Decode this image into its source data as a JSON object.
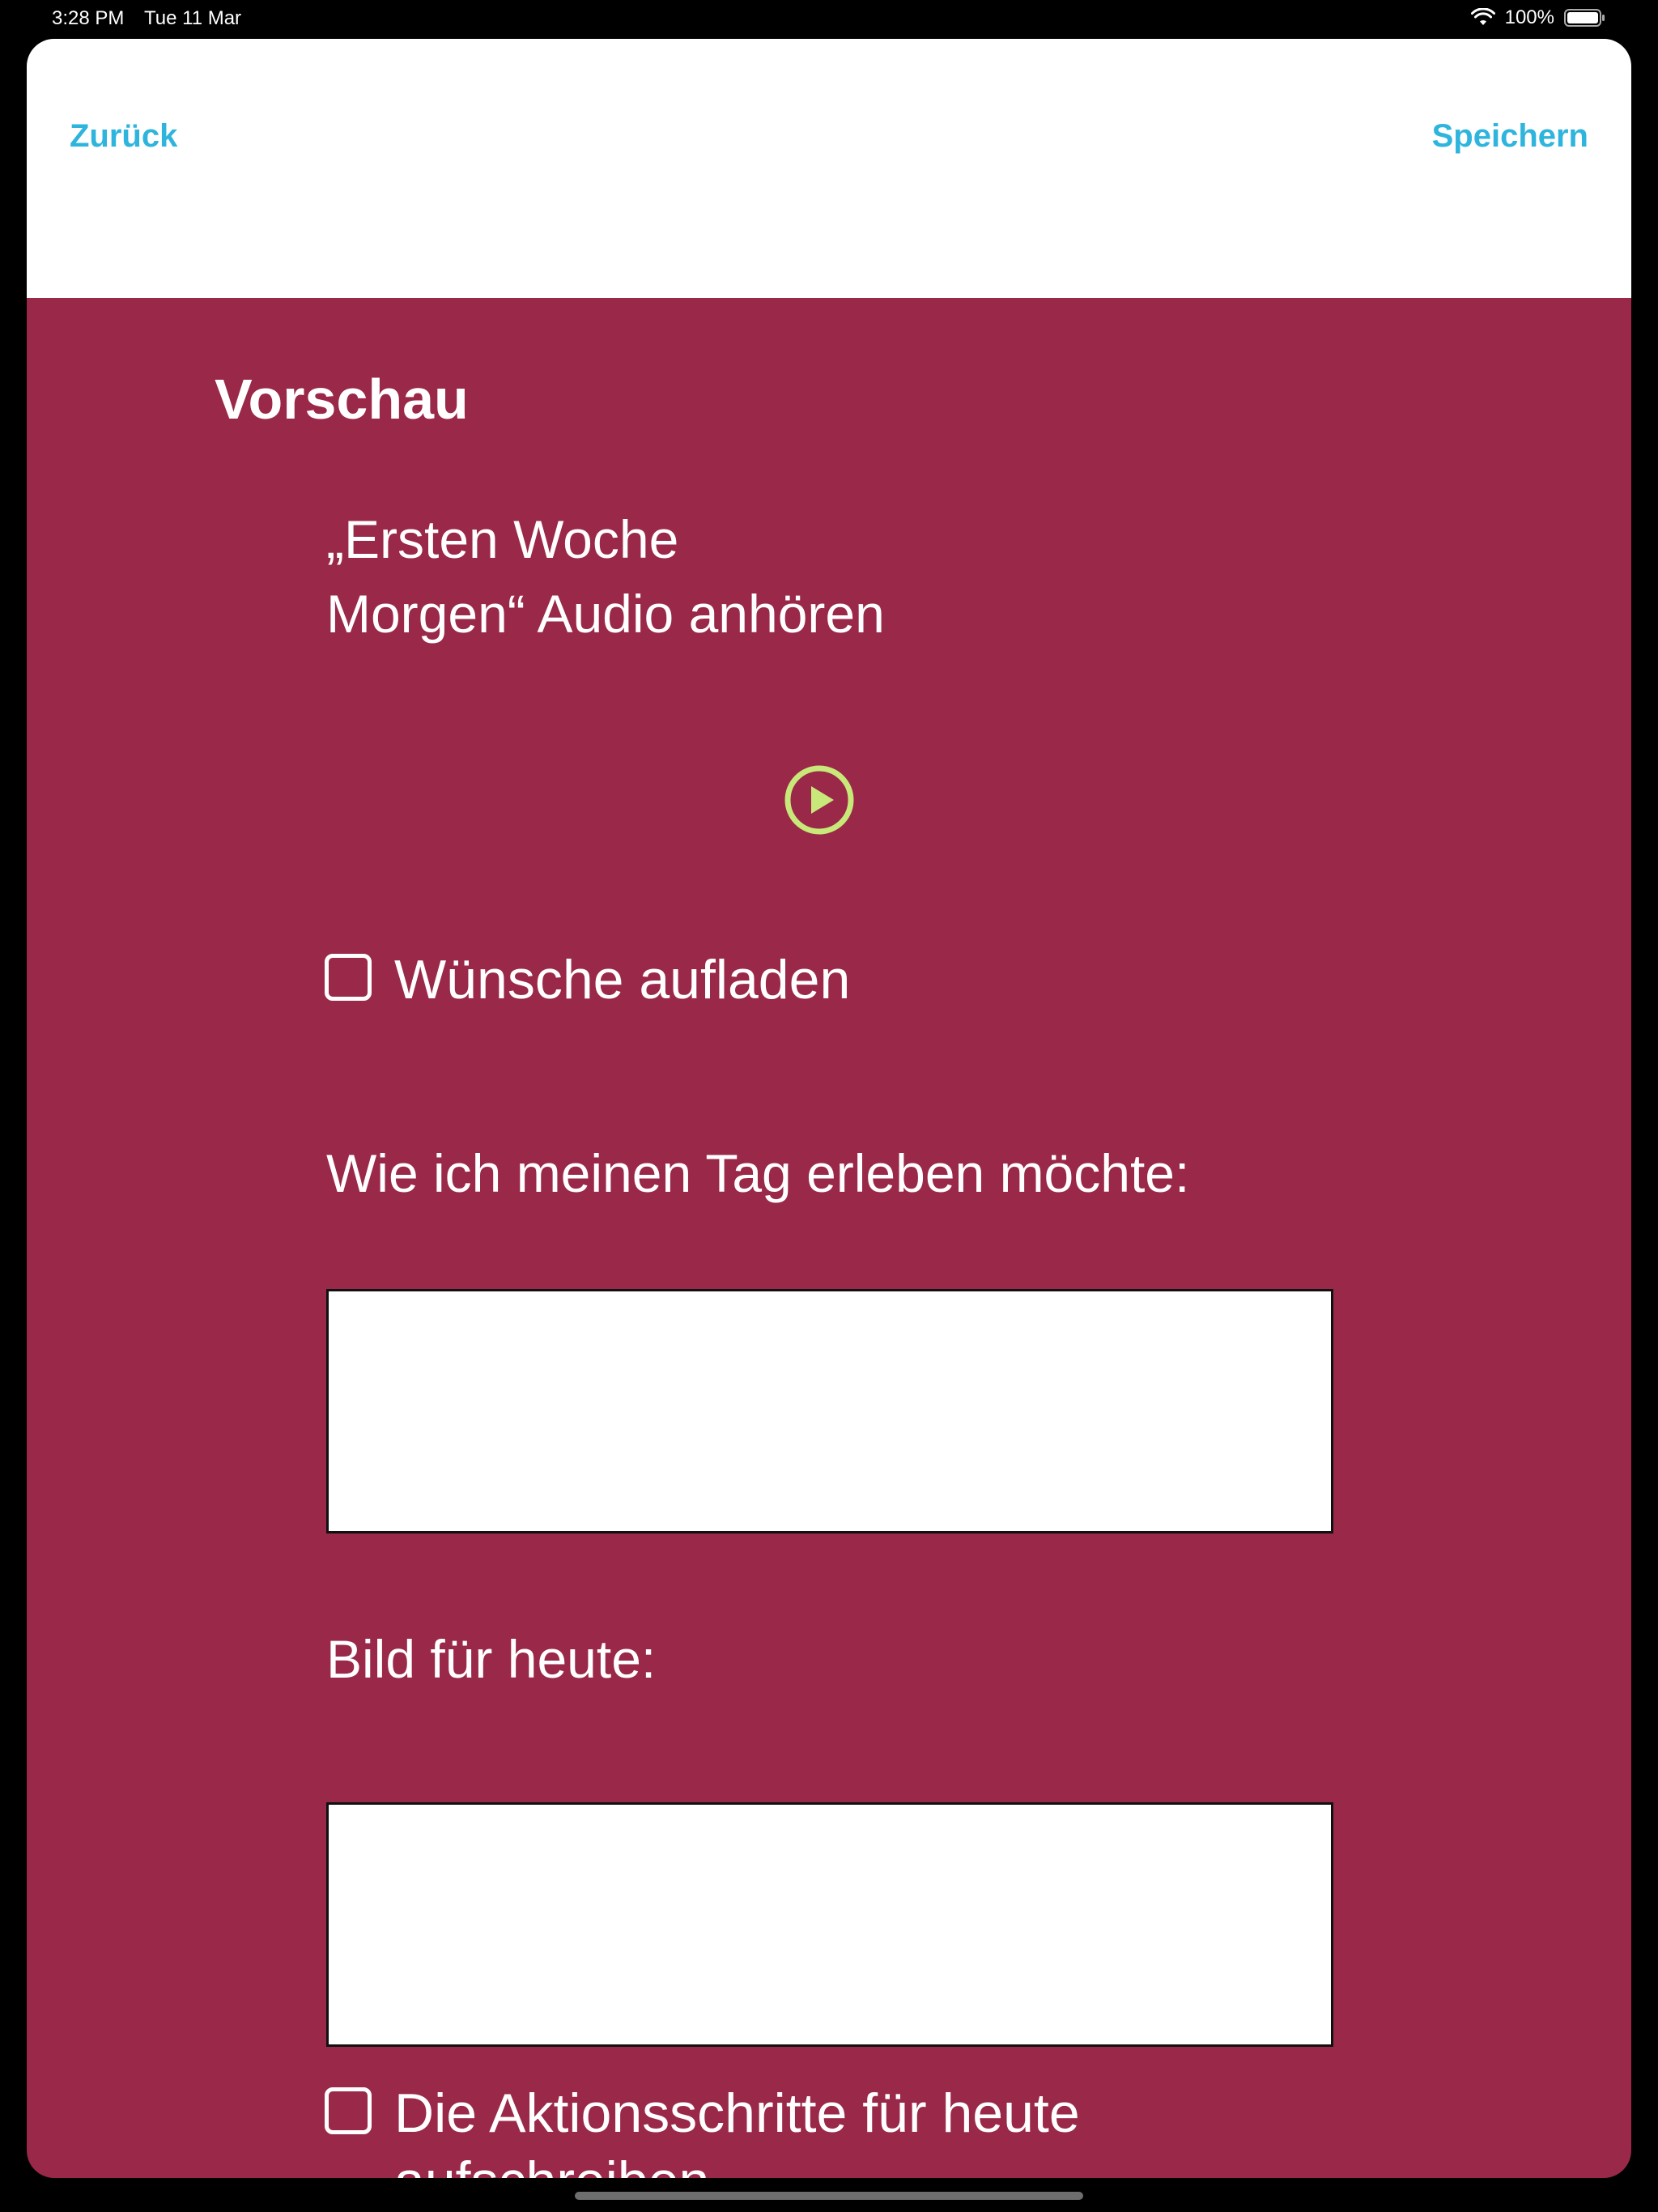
{
  "status_bar": {
    "time": "3:28 PM",
    "date": "Tue 11 Mar",
    "battery": "100%",
    "wifi_icon": "wifi-icon",
    "battery_icon": "battery-icon"
  },
  "nav": {
    "back_label": "Zurück",
    "save_label": "Speichern"
  },
  "content": {
    "title": "Vorschau",
    "audio_title": "„Ersten Woche\nMorgen“ Audio anhören",
    "play_icon": "play-circle-icon",
    "checkbox1_label": "Wünsche aufladen",
    "field1_label": "Wie ich meinen Tag erleben möchte:",
    "field1_value": "",
    "field2_label": "Bild für heute:",
    "field2_value": "",
    "checkbox2_label": "Die Aktionsschritte für heute aufschreiben."
  },
  "colors": {
    "accent": "#2fb5dd",
    "background": "#9a2848",
    "play": "#c9e87a"
  }
}
